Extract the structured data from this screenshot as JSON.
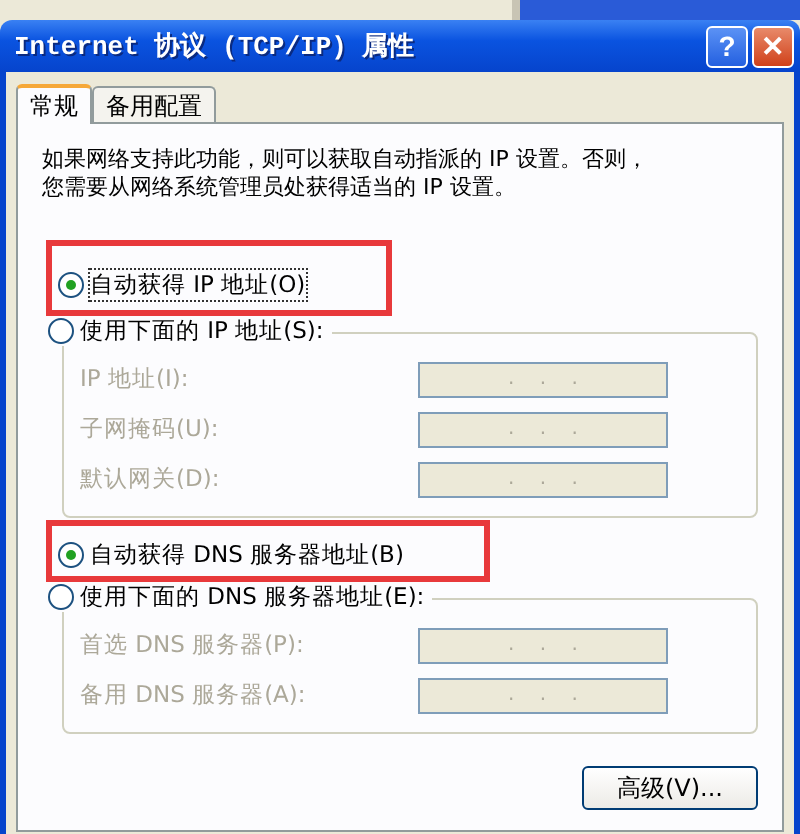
{
  "window": {
    "title": "Internet 协议 (TCP/IP) 属性",
    "buttons": [
      "?",
      "✕"
    ]
  },
  "tabs": [
    {
      "label": "常规",
      "selected": true
    },
    {
      "label": "备用配置",
      "selected": false
    }
  ],
  "intro": [
    "如果网络支持此功能，则可以获取自动指派的 IP 设置。否则，",
    "您需要从网络系统管理员处获得适当的 IP 设置。"
  ],
  "sections": [
    {
      "auto": {
        "label": "自动获得 IP 地址(O)",
        "selected": true,
        "highlighted": true
      },
      "manual": {
        "label": "使用下面的 IP 地址(S):",
        "selected": false
      },
      "fields": [
        {
          "label": "IP 地址(I):",
          "disabled": true,
          "value": ".    .    ."
        },
        {
          "label": "子网掩码(U):",
          "disabled": true,
          "value": ".    .    ."
        },
        {
          "label": "默认网关(D):",
          "disabled": true,
          "value": ".    .    ."
        }
      ]
    },
    {
      "auto": {
        "label": "自动获得 DNS 服务器地址(B)",
        "selected": true,
        "highlighted": true
      },
      "manual": {
        "label": "使用下面的 DNS 服务器地址(E):",
        "selected": false
      },
      "fields": [
        {
          "label": "首选 DNS 服务器(P):",
          "disabled": true,
          "value": ".    .    ."
        },
        {
          "label": "备用 DNS 服务器(A):",
          "disabled": true,
          "value": ".    .    ."
        }
      ]
    }
  ],
  "advanced_button": "高级(V)..."
}
